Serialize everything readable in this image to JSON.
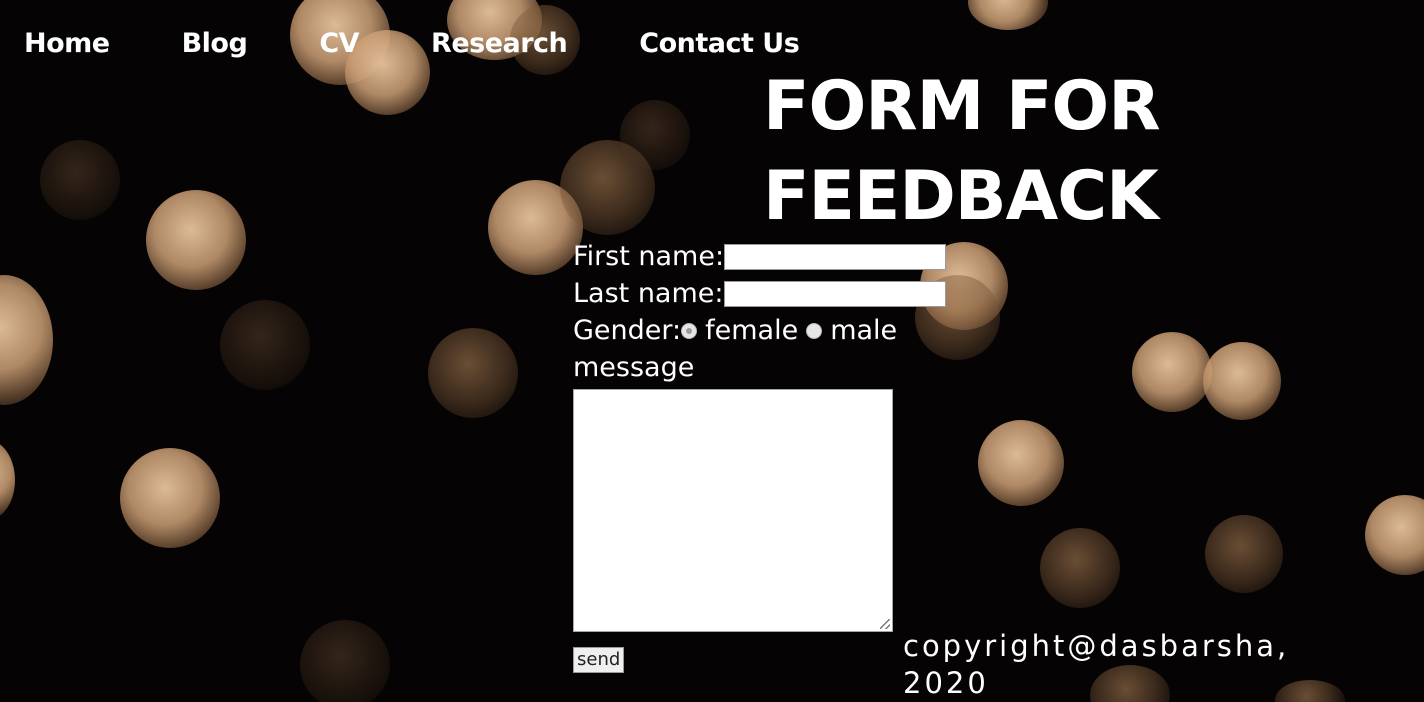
{
  "nav": {
    "items": [
      {
        "label": "Home"
      },
      {
        "label": "Blog"
      },
      {
        "label": "CV"
      },
      {
        "label": "Research"
      },
      {
        "label": "Contact Us"
      }
    ]
  },
  "form": {
    "title_line1": "FORM FOR",
    "title_line2": "FEEDBACK",
    "first_name_label": "First name:",
    "first_name_value": "",
    "last_name_label": "Last name:",
    "last_name_value": "",
    "gender_label": "Gender:",
    "gender_options": [
      {
        "label": "female",
        "selected": true
      },
      {
        "label": "male",
        "selected": false
      }
    ],
    "message_label": "message",
    "message_value": "",
    "send_label": "send"
  },
  "footer": {
    "copyright_line1": "copyright@dasbarsha,",
    "copyright_line2": "2020"
  },
  "colors": {
    "background": "#050303",
    "text": "#ffffff",
    "bokeh": "#d9a97c"
  }
}
